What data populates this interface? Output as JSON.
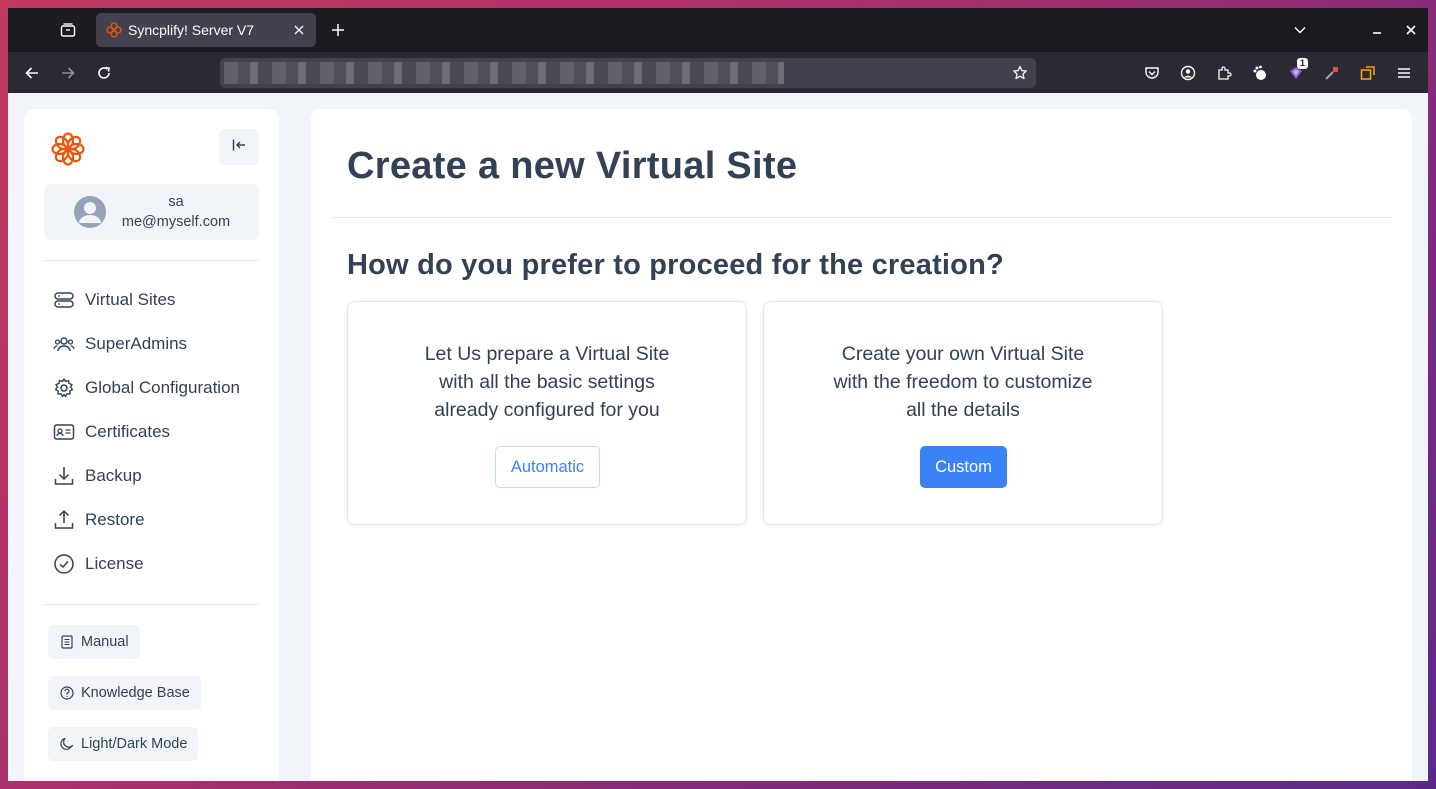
{
  "browser": {
    "tab_title": "Syncplify! Server V7",
    "extension_badge_count": "1"
  },
  "user": {
    "name": "sa",
    "email": "me@myself.com"
  },
  "sidebar": {
    "items": [
      {
        "label": "Virtual Sites",
        "icon": "server-icon"
      },
      {
        "label": "SuperAdmins",
        "icon": "users-icon"
      },
      {
        "label": "Global Configuration",
        "icon": "gear-icon"
      },
      {
        "label": "Certificates",
        "icon": "id-card-icon"
      },
      {
        "label": "Backup",
        "icon": "download-icon"
      },
      {
        "label": "Restore",
        "icon": "upload-icon"
      },
      {
        "label": "License",
        "icon": "check-circle-icon"
      }
    ],
    "footer": [
      {
        "label": "Manual",
        "icon": "document-icon"
      },
      {
        "label": "Knowledge Base",
        "icon": "question-circle-icon"
      },
      {
        "label": "Light/Dark Mode",
        "icon": "moon-icon"
      }
    ]
  },
  "main": {
    "title": "Create a new Virtual Site",
    "subtitle": "How do you prefer to proceed for the creation?",
    "options": [
      {
        "lines": [
          "Let Us prepare a Virtual Site",
          "with all the basic settings",
          "already configured for you"
        ],
        "button": "Automatic"
      },
      {
        "lines": [
          "Create your own Virtual Site",
          "with the freedom to customize",
          "all the details"
        ],
        "button": "Custom"
      }
    ]
  },
  "colors": {
    "accent": "#3b82f6",
    "brand": "#ea580c",
    "text": "#334155"
  }
}
